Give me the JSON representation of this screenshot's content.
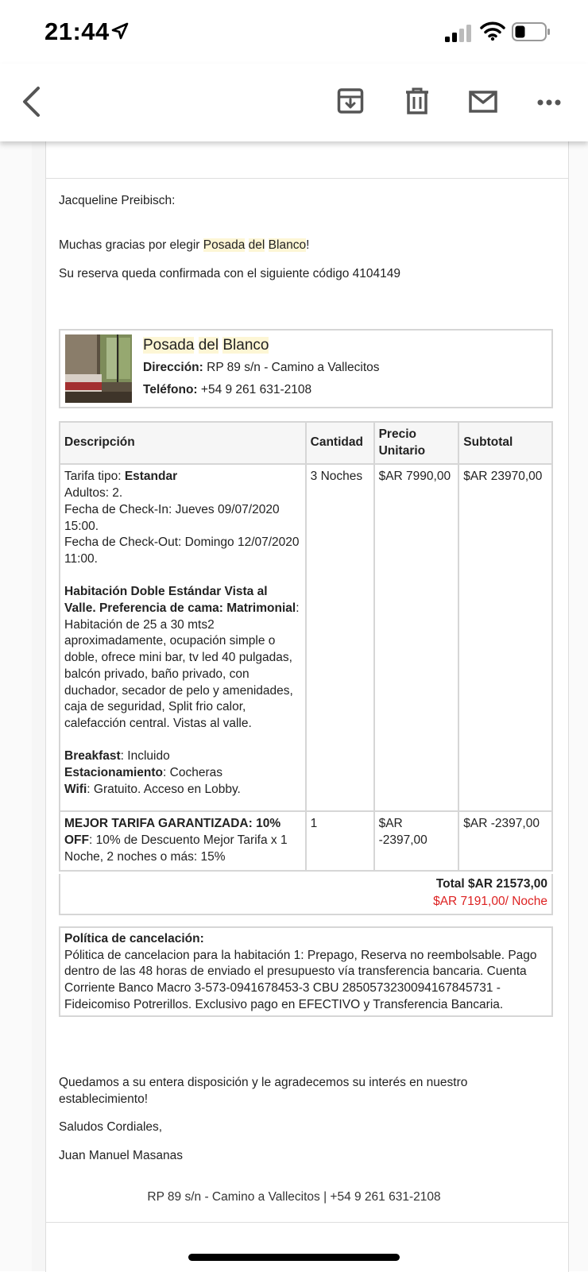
{
  "status_bar": {
    "time": "21:44"
  },
  "toolbar": {
    "icons": [
      "back-icon",
      "archive-icon",
      "trash-icon",
      "mail-icon",
      "more-icon"
    ]
  },
  "email": {
    "greeting": "Jacqueline Preibisch:",
    "thanks_prefix": "Muchas gracias por elegir ",
    "thanks_brand_1": "Posada",
    "thanks_brand_2": "del",
    "thanks_brand_3": "Blanco",
    "thanks_suffix": "!",
    "confirmation": "Su reserva queda confirmada con el siguiente código 4104149",
    "hotel": {
      "name_1": "Posada",
      "name_2": "del",
      "name_3": "Blanco",
      "address_label": "Dirección:",
      "address": "RP 89 s/n - Camino a Vallecitos",
      "phone_label": "Teléfono:",
      "phone": "+54 9 261 631-2108"
    },
    "table": {
      "headers": [
        "Descripción",
        "Cantidad",
        "Precio Unitario",
        "Subtotal"
      ],
      "row1": {
        "rate_label": "Tarifa tipo: ",
        "rate_value": "Estandar",
        "adults": "Adultos: 2.",
        "checkin": "Fecha de Check-In: Jueves 09/07/2020 15:00.",
        "checkout": "Fecha de Check-Out: Domingo 12/07/2020 11:00.",
        "room_title": "Habitación Doble Estándar Vista al Valle. Preferencia de cama: Matrimonial",
        "room_desc": "Habitación de 25 a 30 mts2 aproximadamente, ocupación simple o doble, ofrece mini bar, tv led 40 pulgadas, balcón privado, baño privado, con duchador, secador de pelo y amenidades, caja de seguridad, Split frio calor, calefacción central. Vistas al valle.",
        "breakfast_label": "Breakfast",
        "breakfast_value": ": Incluido",
        "parking_label": "Estacionamiento",
        "parking_value": ": Cocheras",
        "wifi_label": "Wifi",
        "wifi_value": ": Gratuito. Acceso en Lobby.",
        "qty": "3 Noches",
        "unit": "$AR 7990,00",
        "subtotal": "$AR 23970,00"
      },
      "row2": {
        "promo_title": "MEJOR TARIFA GARANTIZADA: 10% OFF",
        "promo_desc": ": 10% de Descuento Mejor Tarifa x 1 Noche, 2 noches o más: 15%",
        "qty": "1",
        "unit": "$AR -2397,00",
        "subtotal": "$AR -2397,00"
      },
      "total": "Total $AR 21573,00",
      "per_night": "$AR 7191,00/ Noche"
    },
    "policy": {
      "title": "Política de cancelación:",
      "text": "Pólitica de cancelacion para la habitación 1: Prepago, Reserva no reembolsable. Pago dentro de las 48 horas de enviado el presupuesto vía transferencia bancaria. Cuenta Corriente Banco Macro 3-573-0941678453-3 CBU 2850573230094167845731 - Fideicomiso Potrerillos. Exclusivo pago en EFECTIVO y Transferencia Bancaria."
    },
    "closing_1": "Quedamos a su entera disposición y le agradecemos su interés en nuestro establecimiento!",
    "closing_2": "Saludos Cordiales,",
    "signature": "Juan Manuel Masanas",
    "footer": "RP 89 s/n - Camino a Vallecitos | +54 9 261 631-2108"
  },
  "colors": {
    "highlight": "#fdf6d5",
    "border": "#d6d6d6",
    "per_night": "#dd2222"
  }
}
